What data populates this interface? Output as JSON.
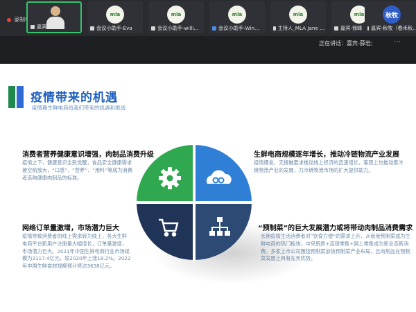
{
  "meeting": {
    "recording_label": "录制中",
    "speaking_label": "正在讲话：嘉宾-薛岩;",
    "participants": [
      {
        "name": "嘉宾-薛岩",
        "type": "video"
      },
      {
        "name": "会议小助手-Eva",
        "type": "logo",
        "logo_text": "mla"
      },
      {
        "name": "会议小助手-willi...",
        "type": "logo",
        "logo_text": "mla"
      },
      {
        "name": "会议小助手-Win...",
        "type": "logo",
        "logo_text": "mla"
      },
      {
        "name": "主持人_MLA Jane ...",
        "type": "logo",
        "logo_text": "mla"
      },
      {
        "name": "嘉宾-徐峰",
        "type": "logo",
        "logo_text": "mla"
      },
      {
        "name": "嘉宾-秋牧（春禾秋...",
        "type": "avatar",
        "logo_text": "秋牧"
      }
    ]
  },
  "slide": {
    "title": "疫情带来的机遇",
    "subtitle": "疫情期生鲜电商给我们带来的机遇和挑战",
    "quadrants": [
      {
        "heading": "消费者营养健康意识增强，肉制品消费升级",
        "body": "疫情之下，健康意识全民觉醒，食品安全健康需求被空前放大，“口感”、“营养”、“用料”等成为消费者选购健康肉制品的标准。",
        "icon": "gear-icon"
      },
      {
        "heading": "生鲜电商规模逐年增长，推动冷链物流产业发展",
        "body": "疫情爆发，无接触要求推动线上经济的迅速增长，客观上也推动着冷链物流产业的发展，为冷链物流市场的扩大提供助力。",
        "icon": "cloud-link-icon"
      },
      {
        "heading": "网络订单量激增，市场潜力巨大",
        "body": "疫情导致消费者的线上需求转为线上，各大生鲜电商平台新用户注册量大幅增长，订单量激增，市场潜力巨大。2021年中国生鲜电商行业市场规模为3117.4亿元，较2020年上涨18.2%。2022年中国生鲜食材规模预计将达3638亿元。",
        "icon": "cart-icon"
      },
      {
        "heading": "“预制菜”的巨大发展潜力或将带动肉制品消费需求",
        "body": "长期疫情生活消费者对”饮食方便“的需求上升，从而使预制菜成为生鲜电商的热门板块，中央厨房+连锁零售+网上零售成为新业态新消费，多家上市公司围绕预制菜加快预制菜产业布局，且肉制品在预制菜发展上具有先天优势。",
        "icon": "network-icon"
      }
    ],
    "colors": {
      "green": "#2fa84f",
      "blue": "#2f7fd6",
      "navy": "#1f3457",
      "slate": "#2d4a74"
    }
  }
}
